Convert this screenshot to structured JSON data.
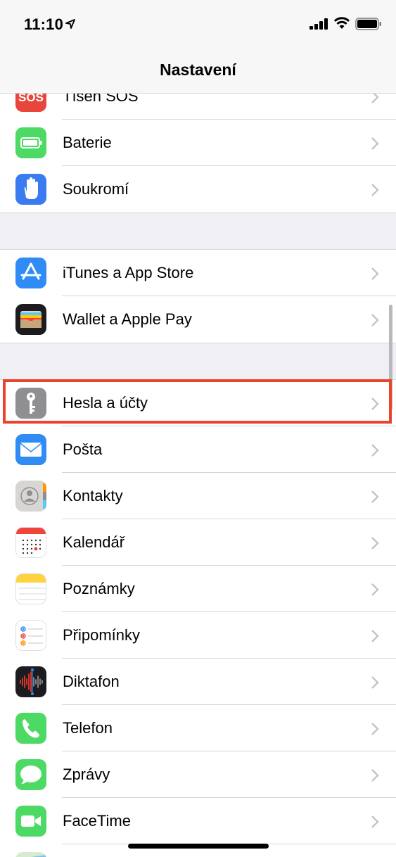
{
  "status_bar": {
    "time": "11:10"
  },
  "nav": {
    "title": "Nastavení"
  },
  "groups": [
    {
      "rows": [
        {
          "label": "Tísen SOS",
          "icon": "sos-icon",
          "color": "#e8453c"
        },
        {
          "label": "Baterie",
          "icon": "battery-icon",
          "color": "#4cd964"
        },
        {
          "label": "Soukromí",
          "icon": "hand-icon",
          "color": "#3a7bf0"
        }
      ]
    },
    {
      "rows": [
        {
          "label": "iTunes a App Store",
          "icon": "app-store-icon",
          "color": "#2f8cf5"
        },
        {
          "label": "Wallet a Apple Pay",
          "icon": "wallet-icon",
          "color": "#1c1c1e"
        }
      ]
    },
    {
      "rows": [
        {
          "label": "Hesla a účty",
          "icon": "key-icon",
          "color": "#8e8e93",
          "highlighted": true
        },
        {
          "label": "Pošta",
          "icon": "mail-icon",
          "color": "#2f8cf5"
        },
        {
          "label": "Kontakty",
          "icon": "contacts-icon",
          "color": "#c8c8cc"
        },
        {
          "label": "Kalendář",
          "icon": "calendar-icon",
          "color": "#ffffff"
        },
        {
          "label": "Poznámky",
          "icon": "notes-icon",
          "color": "#ffd23f"
        },
        {
          "label": "Připomínky",
          "icon": "reminders-icon",
          "color": "#ffffff"
        },
        {
          "label": "Diktafon",
          "icon": "voice-memos-icon",
          "color": "#1c1c1e"
        },
        {
          "label": "Telefon",
          "icon": "phone-icon",
          "color": "#4cd964"
        },
        {
          "label": "Zprávy",
          "icon": "messages-icon",
          "color": "#4cd964"
        },
        {
          "label": "FaceTime",
          "icon": "facetime-icon",
          "color": "#4cd964"
        }
      ]
    }
  ],
  "highlight_color": "#e8452c"
}
